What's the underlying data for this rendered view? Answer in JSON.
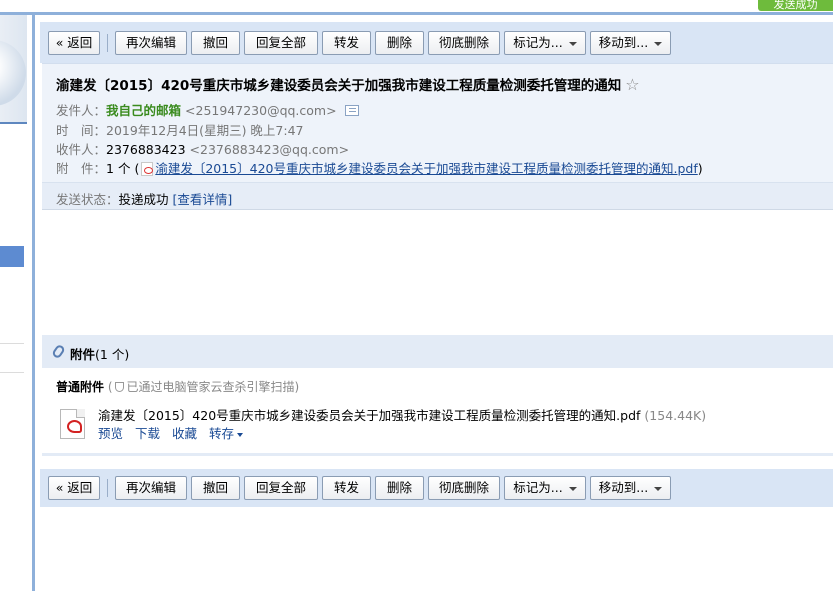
{
  "top_badge": "发送成功",
  "toolbar": {
    "back": "« 返回",
    "edit_again": "再次编辑",
    "recall": "撤回",
    "reply_all": "回复全部",
    "forward": "转发",
    "delete": "删除",
    "delete_permanently": "彻底删除",
    "mark_as": "标记为...",
    "move_to": "移动到..."
  },
  "mail": {
    "subject": "渝建发〔2015〕420号重庆市城乡建设委员会关于加强我市建设工程质量检测委托管理的通知",
    "star": "☆",
    "from_label": "发件人：",
    "from_name": "我自己的邮箱",
    "from_addr": "<251947230@qq.com>",
    "time_label": "时　间：",
    "time_value": "2019年12月4日(星期三) 晚上7:47",
    "to_label": "收件人：",
    "to_name": "2376883423",
    "to_addr": "<2376883423@qq.com>",
    "att_label": "附　件：",
    "att_count": "1 个",
    "att_open": "(",
    "att_close": ")",
    "att_file": "渝建发〔2015〕420号重庆市城乡建设委员会关于加强我市建设工程质量检测委托管理的通知.pdf",
    "status_label": "发送状态：",
    "status_value": "投递成功",
    "status_detail": "[查看详情]"
  },
  "attachments": {
    "title": "附件",
    "count": "(1 个)",
    "normal_label": "普通附件",
    "scan_open": "(",
    "scan_text": "已通过电脑管家云查杀引擎扫描",
    "scan_close": ")",
    "file_name": "渝建发〔2015〕420号重庆市城乡建设委员会关于加强我市建设工程质量检测委托管理的通知.pdf",
    "file_size": "(154.44K)",
    "preview": "预览",
    "download": "下载",
    "favorite": "收藏",
    "save_to": "转存"
  }
}
